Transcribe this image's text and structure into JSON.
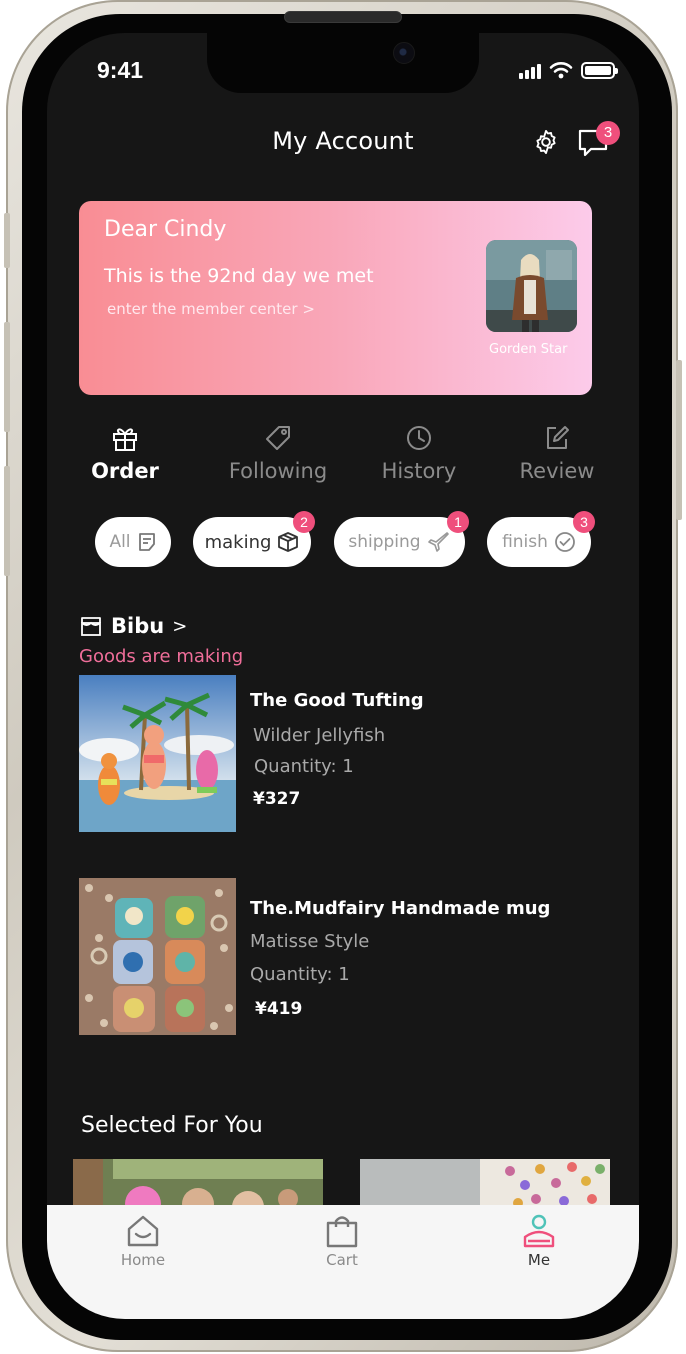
{
  "status": {
    "time": "9:41"
  },
  "header": {
    "title": "My Account",
    "messages_count": "3"
  },
  "member": {
    "greeting": "Dear Cindy",
    "days_text": "This is the 92nd day we met",
    "link_text": "enter the member center >",
    "avatar_caption": "Gorden Star"
  },
  "tabs": [
    {
      "label": "Order",
      "icon": "gift-icon",
      "active": true
    },
    {
      "label": "Following",
      "icon": "tag-icon",
      "active": false
    },
    {
      "label": "History",
      "icon": "clock-icon",
      "active": false
    },
    {
      "label": "Review",
      "icon": "edit-icon",
      "active": false
    }
  ],
  "filters": [
    {
      "label": "All",
      "icon": "list-doc-icon"
    },
    {
      "label": "making",
      "icon": "box-icon",
      "badge": "2"
    },
    {
      "label": "shipping",
      "icon": "airplane-icon",
      "badge": "1"
    },
    {
      "label": "finish",
      "icon": "check-circle-icon",
      "badge": "3"
    }
  ],
  "shop": {
    "name": "Bibu",
    "chevron": ">",
    "status": "Goods are making"
  },
  "products": [
    {
      "title": "The Good Tufting",
      "variant": "Wilder Jellyfish",
      "quantity": "Quantity: 1",
      "price": "¥327"
    },
    {
      "title": "The.Mudfairy Handmade mug",
      "variant": "Matisse Style",
      "quantity": "Quantity: 1",
      "price": "¥419"
    }
  ],
  "selected": {
    "title": "Selected For You"
  },
  "bottom_nav": [
    {
      "label": "Home",
      "icon": "home-icon"
    },
    {
      "label": "Cart",
      "icon": "shopping-bag-icon"
    },
    {
      "label": "Me",
      "icon": "user-icon"
    }
  ],
  "colors": {
    "accent": "#ef4f7c",
    "card_start": "#f98d94",
    "card_end": "#fccbea",
    "background": "#161616"
  }
}
